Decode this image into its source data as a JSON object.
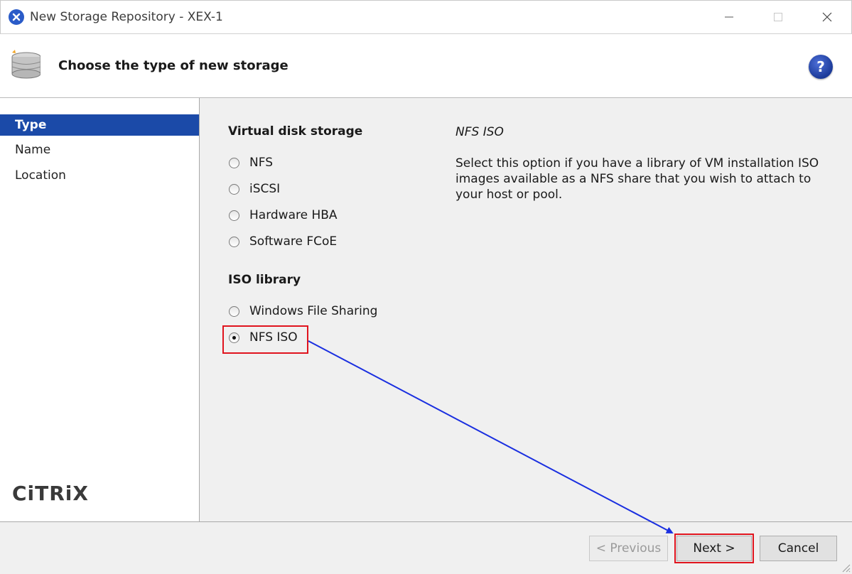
{
  "window": {
    "title": "New Storage Repository - XEX-1"
  },
  "header": {
    "title": "Choose the type of new storage",
    "help_symbol": "?"
  },
  "sidebar": {
    "items": [
      {
        "label": "Type",
        "active": true
      },
      {
        "label": "Name",
        "active": false
      },
      {
        "label": "Location",
        "active": false
      }
    ],
    "logo_text": "CiTRiX"
  },
  "main": {
    "virtual_disk_heading": "Virtual disk storage",
    "virtual_disk_options": [
      "NFS",
      "iSCSI",
      "Hardware HBA",
      "Software FCoE"
    ],
    "iso_heading": "ISO library",
    "iso_options": [
      "Windows File Sharing",
      "NFS ISO"
    ],
    "selected_option": "NFS ISO",
    "description_title": "NFS ISO",
    "description_text": "Select this option if you have a library of VM installation ISO images available as a NFS share that you wish to attach to your host or pool."
  },
  "footer": {
    "previous_label": "< Previous",
    "next_label": "Next >",
    "cancel_label": "Cancel"
  },
  "colors": {
    "accent": "#1b4aa8",
    "highlight": "#e0141e",
    "annotation_arrow": "#1a2fe0"
  }
}
